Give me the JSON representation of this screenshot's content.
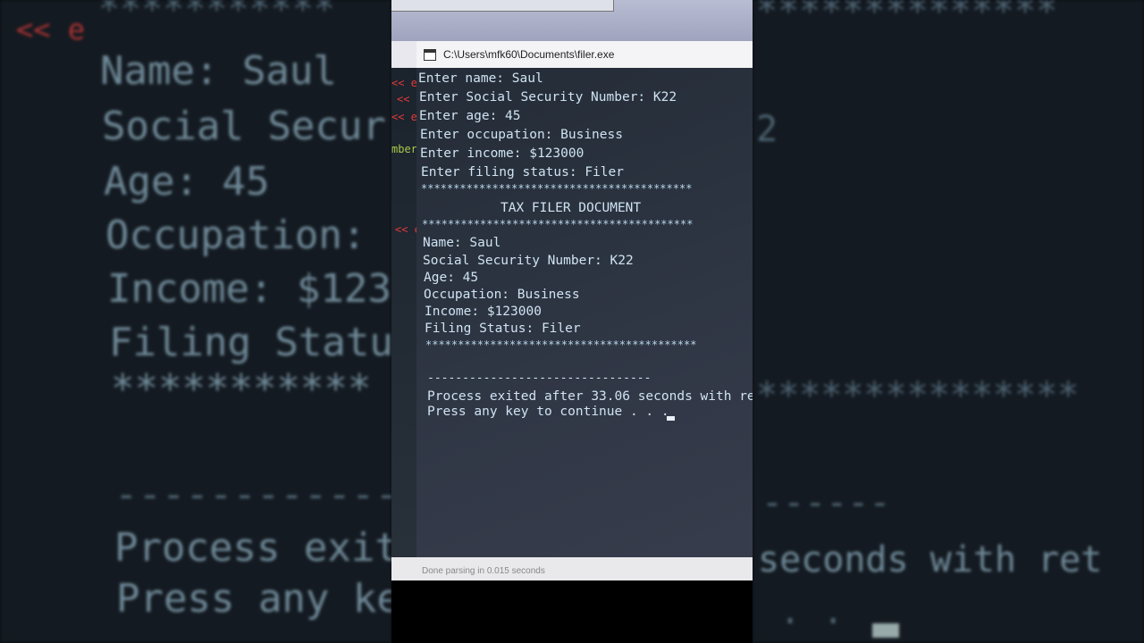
{
  "window": {
    "title": "C:\\Users\\mfk60\\Documents\\filer.exe",
    "status": "Done parsing in 0.015 seconds"
  },
  "console": {
    "prompts": [
      "Enter name: Saul",
      "Enter Social Security Number: K22",
      "Enter age: 45",
      "Enter occupation: Business",
      "Enter income: $123000",
      "Enter filing status: Filer"
    ],
    "stars": "******************************************",
    "document_title": "TAX FILER DOCUMENT",
    "record": [
      "Name: Saul",
      "Social Security Number: K22",
      "Age: 45",
      "Occupation: Business",
      "Income: $123000",
      "Filing Status: Filer"
    ],
    "separator": "--------------------------------",
    "exit_message": "Process exited after 33.06 seconds with ret",
    "continue_prompt": "Press any key to continue . . ."
  },
  "editor_gutter": {
    "markers": [
      "<< e",
      "<< e",
      "<< e",
      "mber",
      "<< e"
    ]
  },
  "background": {
    "left_lines": [
      "Name: Saul",
      "Social Secur",
      "Age: 45",
      "Occupation:",
      "Income: $123",
      "Filing Statu",
      "***********",
      "--------------",
      "Process exit",
      "Press any ke"
    ],
    "left_marker": "<< e",
    "right_lines": [
      "**************",
      "2",
      "***************",
      "------",
      "seconds with ret",
      ". ."
    ]
  }
}
